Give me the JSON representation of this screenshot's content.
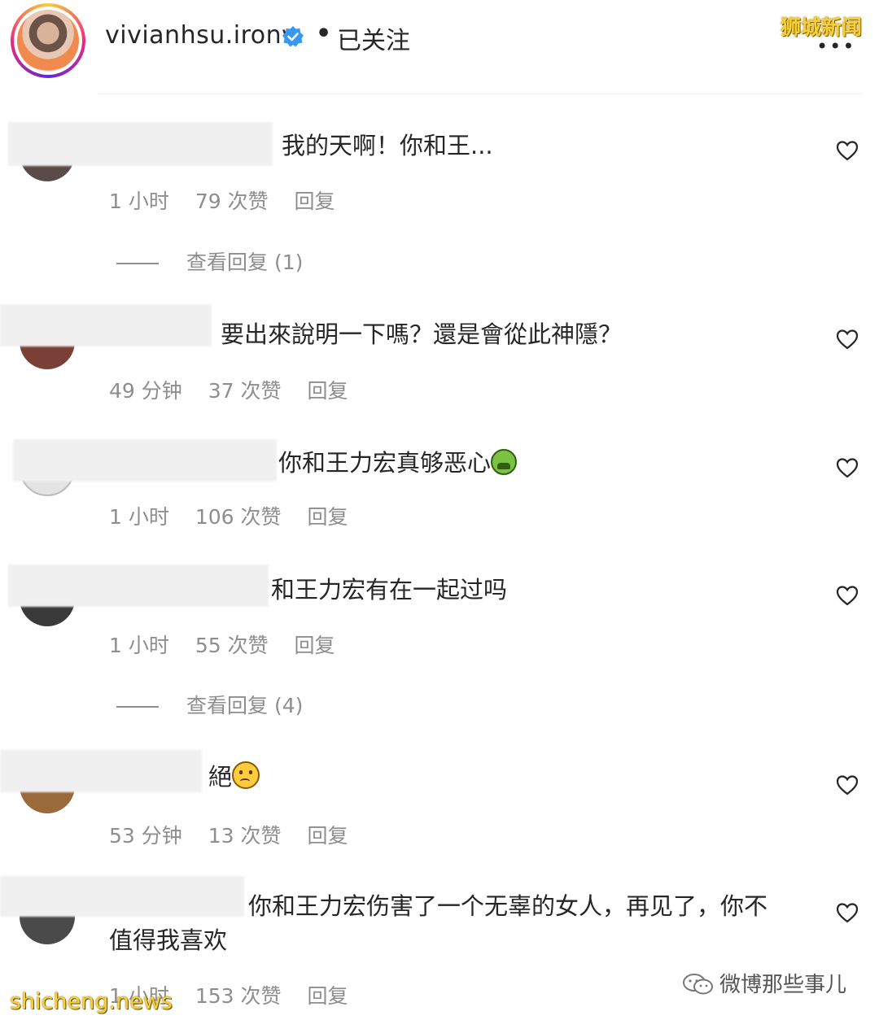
{
  "header": {
    "username": "vivianhsu.ironv",
    "separator": "•",
    "follow_state": "已关注",
    "more": "•••",
    "watermark": "狮城新闻"
  },
  "comments": [
    {
      "text": "我的天啊！你和王...",
      "time": "1 小时",
      "likes": "79 次赞",
      "reply": "回复",
      "view_replies": "查看回复 (1)"
    },
    {
      "text": "要出來說明一下嗎？還是會從此神隱？",
      "time": "49 分钟",
      "likes": "37 次赞",
      "reply": "回复"
    },
    {
      "text": "你和王力宏真够恶心",
      "emoji": "nauseated-face",
      "time": "1 小时",
      "likes": "106 次赞",
      "reply": "回复"
    },
    {
      "text": "和王力宏有在一起过吗",
      "time": "1 小时",
      "likes": "55 次赞",
      "reply": "回复",
      "view_replies": "查看回复 (4)"
    },
    {
      "text": "絕",
      "emoji": "crying-face",
      "time": "53 分钟",
      "likes": "13 次赞",
      "reply": "回复"
    },
    {
      "text_line1": "你和王力宏伤害了一个无辜的女人，再见了，你不",
      "text_line2": "值得我喜欢",
      "time": "1 小时",
      "likes": "153 次赞",
      "reply": "回复"
    }
  ],
  "footer": {
    "watermark": "shicheng.news",
    "brand": "微博那些事儿"
  },
  "colors": {
    "text": "#262626",
    "meta": "#8e8e8e",
    "verified": "#3897f0",
    "watermark": "#f7d038"
  }
}
